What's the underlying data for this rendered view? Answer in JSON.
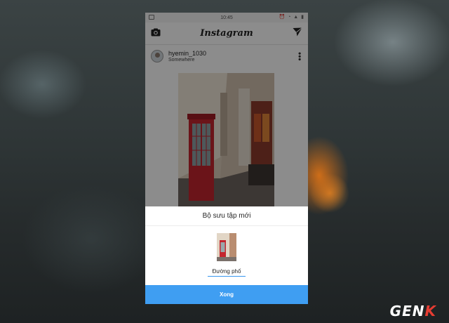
{
  "status_bar": {
    "time": "10:45",
    "icons": "⏰ ◔ ▲ ▮"
  },
  "header": {
    "title": "Instagram",
    "left_icon": "camera-icon",
    "right_icon": "direct-send-icon"
  },
  "post": {
    "username": "hyemin_1030",
    "location": "Somewhere",
    "menu_icon": "more-vertical-icon"
  },
  "sheet": {
    "title": "Bộ sưu tập mới",
    "name_value": "Đường phố",
    "done_label": "Xong"
  },
  "watermark": {
    "text_main": "GEN",
    "text_accent": "K"
  },
  "colors": {
    "accent": "#3f9ef2",
    "watermark_accent": "#e63c32"
  }
}
